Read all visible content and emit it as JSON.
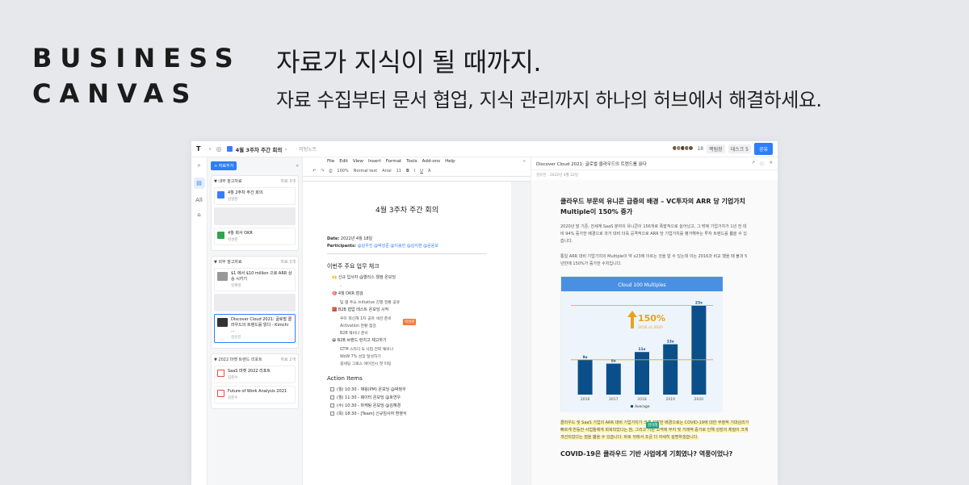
{
  "hero": {
    "brand_line1": "BUSINESS",
    "brand_line2": "CANVAS",
    "headline": "자료가 지식이 될 때까지.",
    "subline": "자료 수집부터 문서 협업, 지식 관리까지 하나의 허브에서 해결하세요."
  },
  "topbar": {
    "logo": "T",
    "doc_title": "4월 3주차 주간 회의",
    "path": "· 미팅노트",
    "member_count": "18",
    "user1": "백팀장",
    "user2": "데스크",
    "badge": "5",
    "share_label": "공유"
  },
  "rail": {
    "all_label": "All"
  },
  "sidebar": {
    "add_label": "+ 자료추가",
    "groups": [
      {
        "title": "▼ 내부 참고자료",
        "count": "자료 3개",
        "cards": [
          {
            "title": "4월 2주차 주간 회의",
            "sub": "김영준"
          },
          {
            "title": "",
            "sub": ""
          },
          {
            "title": "4월 회사 OKR",
            "sub": "박성준"
          }
        ]
      },
      {
        "title": "▼ 외부 참고자료",
        "count": "자료 3개",
        "cards": [
          {
            "title": "$1 에서 $10 million 으로 ARR 상승 시키기",
            "sub": "김혜영"
          },
          {
            "title": "",
            "sub": ""
          },
          {
            "title": "Discover Cloud 2021: 글로벌 클라우드의 트렌드를 읽다 - Kimchi ...",
            "sub": "김유진"
          }
        ]
      },
      {
        "title": "▼ 2022 마켓 트렌드 리포트",
        "count": "자료 2개",
        "cards": [
          {
            "title": "SaaS 마켓 2022 리포트",
            "sub": "김준수"
          },
          {
            "title": "Future of Work Analysis 2021",
            "sub": "김준수"
          }
        ]
      }
    ]
  },
  "editor": {
    "menu": [
      "File",
      "Edit",
      "View",
      "Insert",
      "Format",
      "Tools",
      "Add-ons",
      "Help"
    ],
    "toolbar": {
      "zoom": "100%",
      "style": "Normal text",
      "font": "Arial",
      "size": "11"
    },
    "doc_title": "4월 3주차 주간 회의",
    "date_label": "Date:",
    "date_value": "2022년 4월 18일",
    "participants_label": "Participants:",
    "participants_value": "@김우진 @박성준 @이송민 @김지현 @윤윤모",
    "section1": "이번주 주요 업무 체크",
    "items": [
      {
        "text": "🙌 신규 입사자 @엘리스 웰컴 온보딩",
        "subs": [
          "-"
        ]
      },
      {
        "text": "🎯 4월 OKR 점검",
        "subs": [
          "팀 별 주요 initiative 진행 현황 공유"
        ]
      },
      {
        "text": "🧱 B2B 협업 테스트 온보딩 시작",
        "subs": [
          "우미 회신해 1차 공유 세션 준비",
          "Activation 현황 점검",
          "B2B 웨비나 준비"
        ]
      },
      {
        "text": "😀 B2B 브랜드 런치고 체고하기",
        "subs": [
          "GTM 스타디 & 사업 전략 웨비나",
          "WoW 7% 성장 달성하기",
          "광세팅 그로스 애이전시 첫 미팅"
        ]
      }
    ],
    "cursor_tag": "박성준",
    "section2": "Action Items",
    "todos": [
      "(월) 10:30 - 채용(PM) 온보딩 @박정우",
      "(월) 11:30 - 웨이터 온보딩 @호연우",
      "(수) 10:30 - 마케팅 온보딩 @김혜경",
      "(목) 18:30 - [Team] 신규임사자 환영식"
    ]
  },
  "article": {
    "header_title": "Discover Cloud 2021: 글로벌 클라우드의 트렌드를 읽다",
    "meta_author": "김유진",
    "meta_date": "2022년 4월 22일",
    "title": "클라우드 부문의 유니콘 급증의 배경 – VC투자의 ARR 당 기업가치 Multiple이 150% 증가",
    "p1": "2020년 말 기준, 전세계 SaaS 분야의 유니콘이 156개로 폭발적으로 늘어났고, 그 밖에 기업가치가 1년 전 대비 94% 증가한 배경으로 과거 대비 더욱 공격적으로 ARR 당 기업가치를 평가해주는 투자 트렌드를 뽑을 수 있습니다.",
    "p2": "통일 ARR 대비 기업가치의 Multiple이 약 x23에 이르는 것을 알 수 있는데 이는 2016과 비교 했을 때 불과 5년만에 150%가 증가한 수치입니다.",
    "p3": "클라우드 및 SaaS 기업의 ARR 대비 기업가치가 크게 성장한 배경으로는 COVID-19에 대한 부정적 기대심리가 빠르게 반등한 사업들에게 회복되었다는 점, 그리고 기존 고객에 부지 및 거래액 증가로 인해 성장의 체질이 크게 개선되었다는 점을 뽑을 수 있습니다. 바로 뒤에서 조금 더 자세히 설명하겠습니다.",
    "green_tag": "김이래",
    "h2": "COVID-19은 클라우드 기반 사업에게 기회였나? 역풍이었나?"
  },
  "chart_data": {
    "type": "bar",
    "title": "Cloud 100 Multiples",
    "categories": [
      "2016",
      "2017",
      "2018",
      "2019",
      "2020"
    ],
    "series": [
      {
        "name": "Average",
        "values": [
          9,
          8,
          11,
          13,
          23
        ]
      }
    ],
    "data_labels": [
      "9x",
      "8x",
      "11x",
      "13x",
      "23x"
    ],
    "annotation_value": "150%",
    "annotation_sub": "2016 vs 2020",
    "ylim": [
      0,
      25
    ],
    "legend": "bottom",
    "colors": {
      "bar": "#0b4f8a",
      "header": "#4a90e2",
      "line": "#e8a317",
      "annotation": "#e8a317"
    }
  }
}
